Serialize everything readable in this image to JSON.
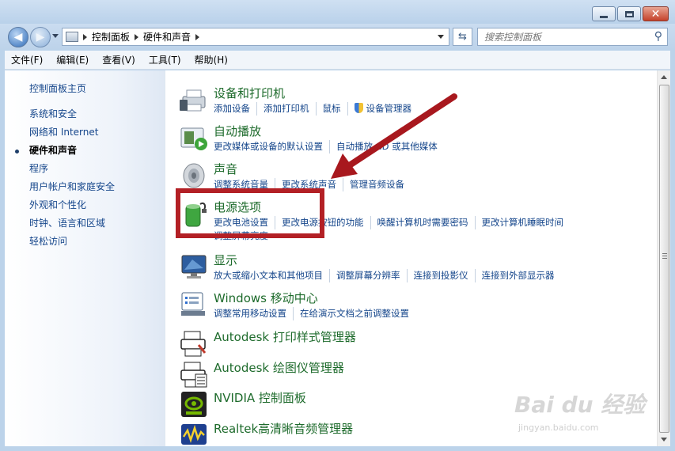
{
  "window": {
    "search_placeholder": "搜索控制面板"
  },
  "breadcrumb": [
    "控制面板",
    "硬件和声音"
  ],
  "menubar": [
    "文件(F)",
    "编辑(E)",
    "查看(V)",
    "工具(T)",
    "帮助(H)"
  ],
  "sidebar": {
    "home": "控制面板主页",
    "items": [
      {
        "label": "系统和安全",
        "active": false
      },
      {
        "label": "网络和 Internet",
        "active": false
      },
      {
        "label": "硬件和声音",
        "active": true
      },
      {
        "label": "程序",
        "active": false
      },
      {
        "label": "用户帐户和家庭安全",
        "active": false
      },
      {
        "label": "外观和个性化",
        "active": false
      },
      {
        "label": "时钟、语言和区域",
        "active": false
      },
      {
        "label": "轻松访问",
        "active": false
      }
    ]
  },
  "categories": [
    {
      "title": "设备和打印机",
      "icon": "printer-icon",
      "links": [
        "添加设备",
        "添加打印机",
        "鼠标",
        "设备管理器"
      ]
    },
    {
      "title": "自动播放",
      "icon": "autoplay-icon",
      "links": [
        "更改媒体或设备的默认设置",
        "自动播放 CD 或其他媒体"
      ]
    },
    {
      "title": "声音",
      "icon": "speaker-icon",
      "links": [
        "调整系统音量",
        "更改系统声音",
        "管理音频设备"
      ]
    },
    {
      "title": "电源选项",
      "icon": "battery-icon",
      "links": [
        "更改电池设置",
        "更改电源按钮的功能",
        "唤醒计算机时需要密码",
        "更改计算机睡眠时间",
        "调整屏幕亮度"
      ]
    },
    {
      "title": "显示",
      "icon": "monitor-icon",
      "links": [
        "放大或缩小文本和其他项目",
        "调整屏幕分辨率",
        "连接到投影仪",
        "连接到外部显示器"
      ]
    },
    {
      "title": "Windows 移动中心",
      "icon": "mobility-center-icon",
      "links": [
        "调整常用移动设置",
        "在给演示文档之前调整设置"
      ]
    },
    {
      "title": "Autodesk 打印样式管理器",
      "icon": "autodesk-plot-style-icon",
      "links": []
    },
    {
      "title": "Autodesk 绘图仪管理器",
      "icon": "autodesk-plotter-icon",
      "links": []
    },
    {
      "title": "NVIDIA 控制面板",
      "icon": "nvidia-icon",
      "links": []
    },
    {
      "title": "Realtek高清晰音频管理器",
      "icon": "realtek-icon",
      "links": []
    }
  ],
  "annotation": {
    "box_color": "#b32025",
    "arrow_color": "#a8181e"
  },
  "watermark": {
    "main": "Bai du 经验",
    "sub": "jingyan.baidu.com"
  }
}
